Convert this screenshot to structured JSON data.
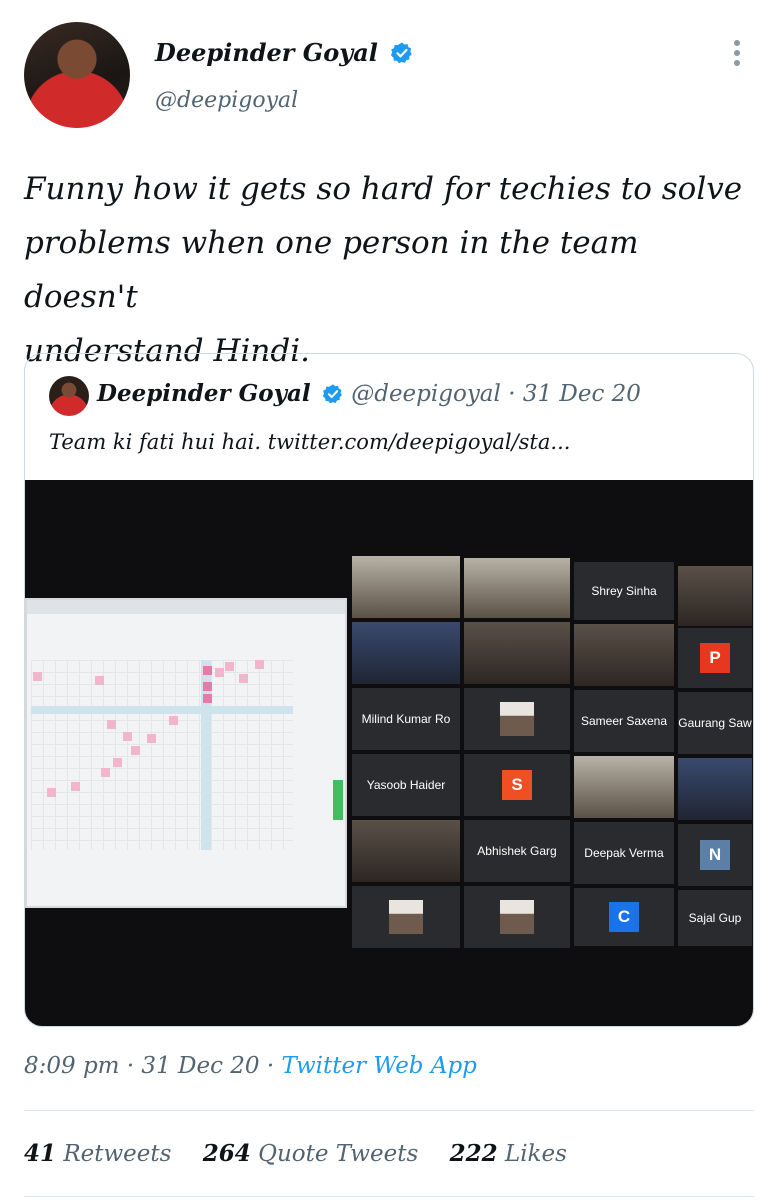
{
  "author": {
    "name": "Deepinder Goyal",
    "handle": "@deepigoyal"
  },
  "tweet": {
    "line1": "Funny how it gets so hard for techies to solve",
    "line2": "problems when one person in the team doesn't",
    "line3": "understand Hindi."
  },
  "quoted": {
    "name": "Deepinder Goyal",
    "handle": "@deepigoyal",
    "date": "· 31 Dec 20",
    "text": "Team ki fati hui hai. twitter.com/deepigoyal/sta..."
  },
  "participants": [
    "Shrey Sinha",
    "Milind Kumar Ro",
    "Sameer Saxena",
    "Gaurang Saw",
    "Yasoob Haider",
    "Abhishek Garg",
    "Deepak Verma",
    "Sajal Gup"
  ],
  "letters": [
    "P",
    "S",
    "N",
    "C"
  ],
  "meta": {
    "time": "8:09 pm",
    "date": "· 31 Dec 20 ·",
    "app": "Twitter Web App"
  },
  "stats": {
    "retweets_num": "41",
    "retweets_label": "Retweets",
    "quotes_num": "264",
    "quotes_label": "Quote Tweets",
    "likes_num": "222",
    "likes_label": "Likes"
  },
  "colors": {
    "link": "#1d9bf0",
    "muted": "#536471",
    "verified": "#1d9bf0",
    "letter_p": "#e8371f",
    "letter_s": "#f04e23",
    "letter_n": "#5c7fa8",
    "letter_c": "#1a73e8"
  }
}
